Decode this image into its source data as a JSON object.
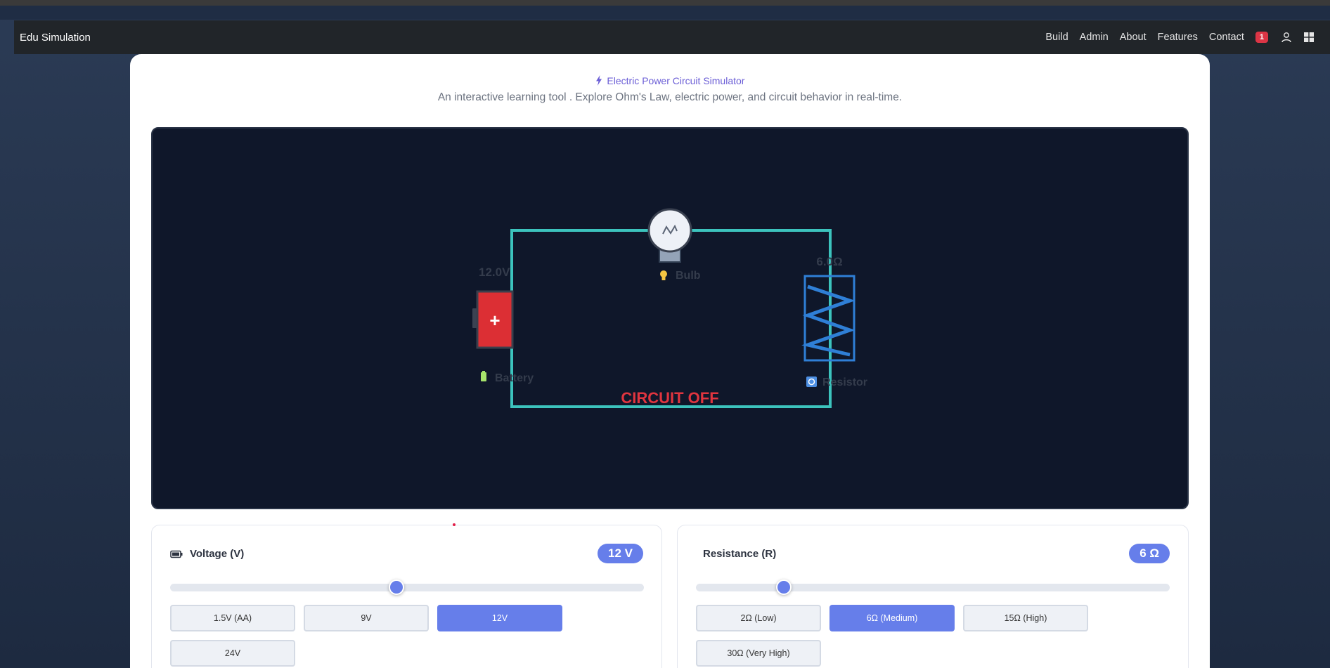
{
  "navbar": {
    "brand": "Edu Simulation",
    "links": [
      "Build",
      "Admin",
      "About",
      "Features",
      "Contact"
    ],
    "notification_count": "1",
    "icons": [
      "user-icon",
      "windows-icon"
    ]
  },
  "header": {
    "title": "Electric Power Circuit Simulator",
    "subtitle": "An interactive learning tool . Explore Ohm's Law, electric power, and circuit behavior in real-time."
  },
  "circuit": {
    "battery_value": "12.0V",
    "battery_label": "Battery",
    "battery_symbol": "+",
    "bulb_label": "Bulb",
    "resistor_value": "6.0Ω",
    "resistor_label": "Resistor",
    "status": "CIRCUIT OFF"
  },
  "voltage_panel": {
    "title": "Voltage (V)",
    "value": "12 V",
    "slider_level": 0.478,
    "presets": [
      {
        "label": "1.5V (AA)",
        "active": false
      },
      {
        "label": "9V",
        "active": false
      },
      {
        "label": "12V",
        "active": true
      },
      {
        "label": "24V",
        "active": false
      }
    ]
  },
  "resistance_panel": {
    "title": "Resistance (R)",
    "value": "6 Ω",
    "slider_level": 0.185,
    "presets": [
      {
        "label": "2Ω (Low)",
        "active": false
      },
      {
        "label": "6Ω (Medium)",
        "active": true
      },
      {
        "label": "15Ω (High)",
        "active": false
      },
      {
        "label": "30Ω (Very High)",
        "active": false
      }
    ]
  },
  "colors": {
    "accent": "#667eea",
    "wire": "#3cc3bd",
    "battery": "#dc2f34",
    "resistor": "#2f7fd6",
    "status_off": "#e0353f",
    "title": "#6b5ed6",
    "badge": "#dc3545"
  }
}
